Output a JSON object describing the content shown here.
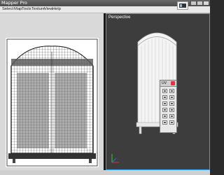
{
  "window": {
    "title": "Mapper Pro"
  },
  "menu": {
    "items": [
      {
        "id": "select",
        "label": "Select"
      },
      {
        "id": "map",
        "label": "Map"
      },
      {
        "id": "tools",
        "label": "Tools"
      },
      {
        "id": "texture",
        "label": "Texture"
      },
      {
        "id": "view",
        "label": "View"
      },
      {
        "id": "help",
        "label": "Help"
      }
    ]
  },
  "viewports": {
    "right": {
      "label": "Perspective"
    }
  },
  "tool_panel": {
    "title": "UV",
    "button_count": 12
  },
  "colors": {
    "accent": "#2aa0ff",
    "viewport_bg": "#3d3d3d",
    "uv_bg": "#d9d9d9"
  }
}
